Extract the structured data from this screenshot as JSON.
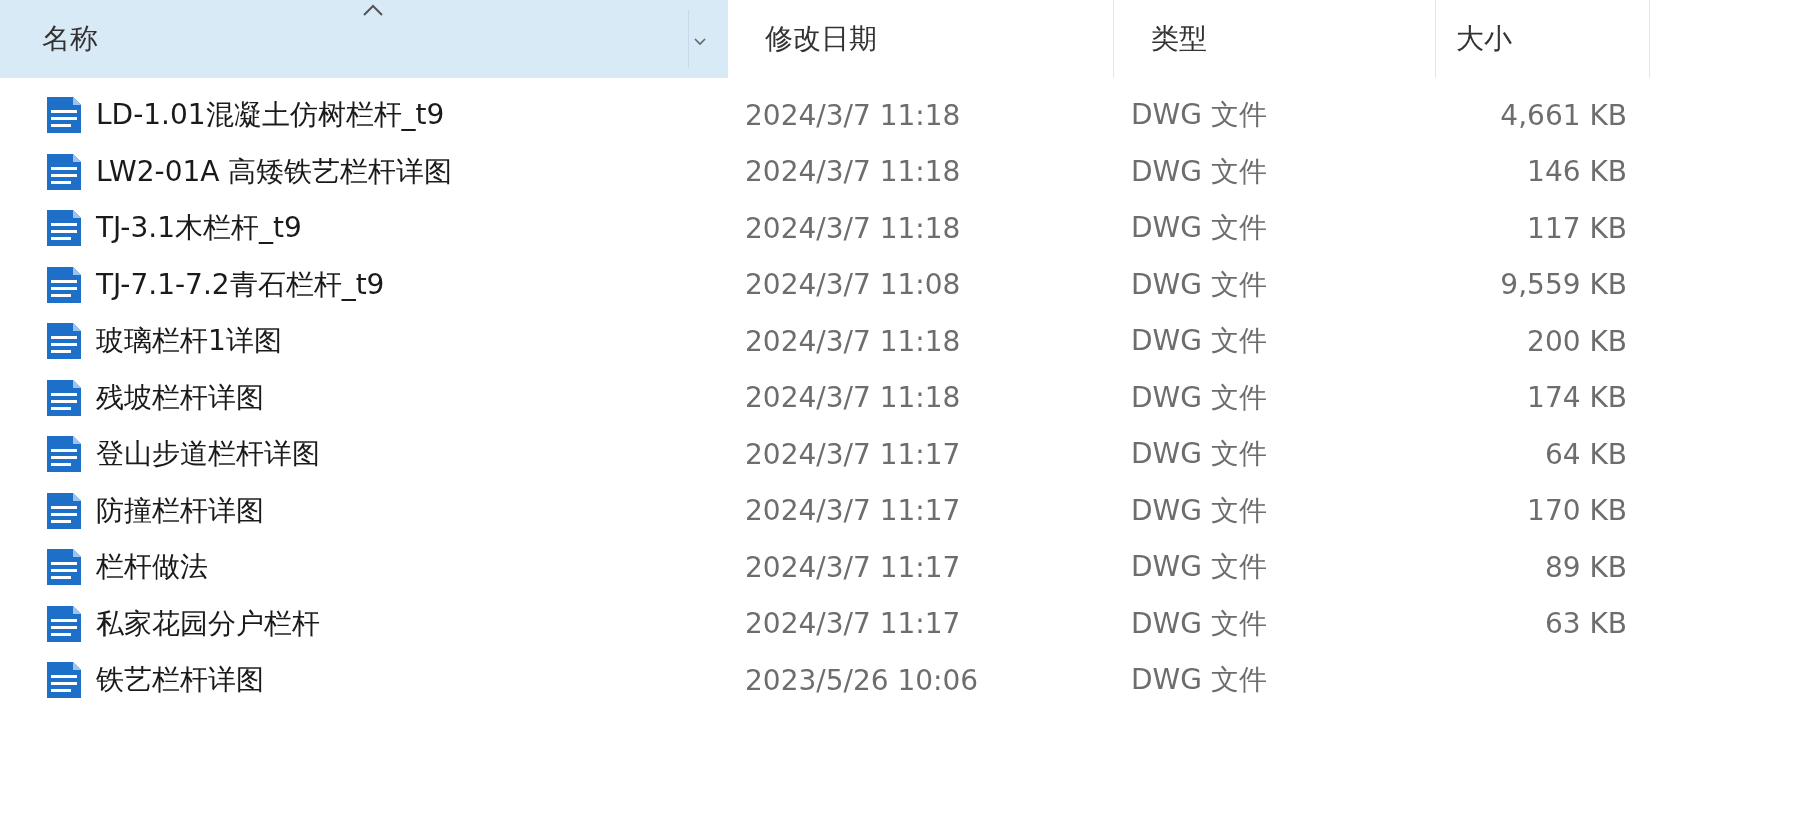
{
  "columns": [
    {
      "label": "名称",
      "selected": true
    },
    {
      "label": "修改日期",
      "selected": false
    },
    {
      "label": "类型",
      "selected": false
    },
    {
      "label": "大小",
      "selected": false
    }
  ],
  "rows": [
    {
      "name": "LD-1.01混凝土仿树栏杆_t9",
      "modified": "2024/3/7 11:18",
      "type": "DWG 文件",
      "size": "4,661 KB"
    },
    {
      "name": "LW2-01A 高矮铁艺栏杆详图",
      "modified": "2024/3/7 11:18",
      "type": "DWG 文件",
      "size": "146 KB"
    },
    {
      "name": "TJ-3.1木栏杆_t9",
      "modified": "2024/3/7 11:18",
      "type": "DWG 文件",
      "size": "117 KB"
    },
    {
      "name": "TJ-7.1-7.2青石栏杆_t9",
      "modified": "2024/3/7 11:08",
      "type": "DWG 文件",
      "size": "9,559 KB"
    },
    {
      "name": "玻璃栏杆1详图",
      "modified": "2024/3/7 11:18",
      "type": "DWG 文件",
      "size": "200 KB"
    },
    {
      "name": "残坡栏杆详图",
      "modified": "2024/3/7 11:18",
      "type": "DWG 文件",
      "size": "174 KB"
    },
    {
      "name": "登山步道栏杆详图",
      "modified": "2024/3/7 11:17",
      "type": "DWG 文件",
      "size": "64 KB"
    },
    {
      "name": "防撞栏杆详图",
      "modified": "2024/3/7 11:17",
      "type": "DWG 文件",
      "size": "170 KB"
    },
    {
      "name": "栏杆做法",
      "modified": "2024/3/7 11:17",
      "type": "DWG 文件",
      "size": "89 KB"
    },
    {
      "name": "私家花园分户栏杆",
      "modified": "2024/3/7 11:17",
      "type": "DWG 文件",
      "size": "63 KB"
    },
    {
      "name": "铁艺栏杆详图",
      "modified": "2023/5/26 10:06",
      "type": "DWG 文件"
    }
  ]
}
